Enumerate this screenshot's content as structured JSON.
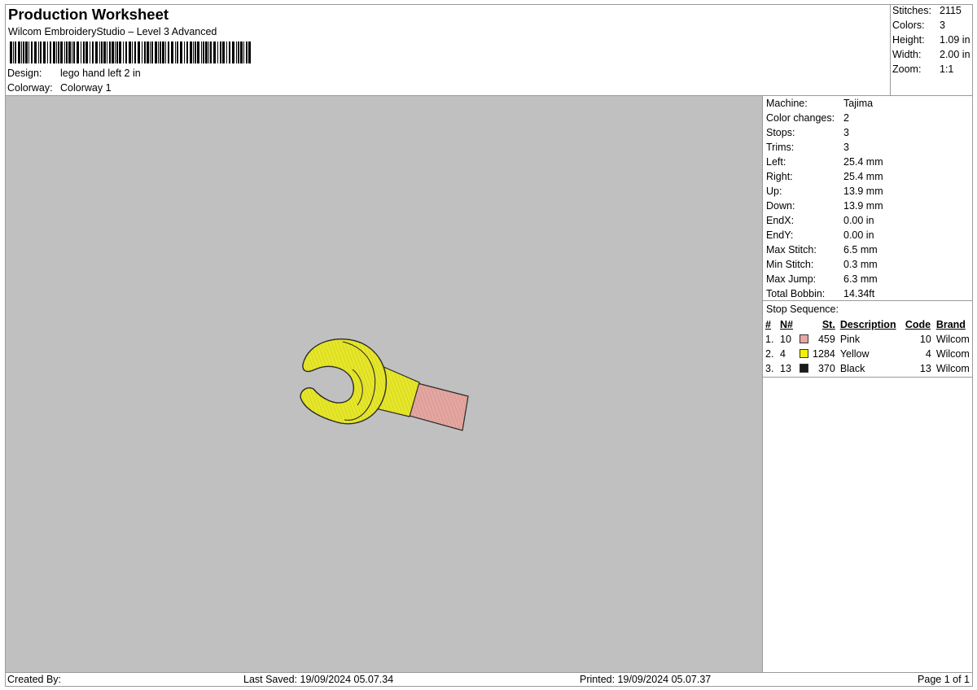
{
  "header": {
    "title": "Production Worksheet",
    "software": "Wilcom EmbroideryStudio – Level 3 Advanced",
    "design_label": "Design:",
    "design_value": "lego hand left 2 in",
    "colorway_label": "Colorway:",
    "colorway_value": "Colorway 1"
  },
  "stats": {
    "stitches_label": "Stitches:",
    "stitches_value": "2115",
    "colors_label": "Colors:",
    "colors_value": "3",
    "height_label": "Height:",
    "height_value": "1.09 in",
    "width_label": "Width:",
    "width_value": "2.00 in",
    "zoom_label": "Zoom:",
    "zoom_value": "1:1"
  },
  "machine": {
    "rows": [
      {
        "label": "Machine:",
        "value": "Tajima"
      },
      {
        "label": "Color changes:",
        "value": "2"
      },
      {
        "label": "Stops:",
        "value": "3"
      },
      {
        "label": "Trims:",
        "value": "3"
      },
      {
        "label": "Left:",
        "value": "25.4 mm"
      },
      {
        "label": "Right:",
        "value": "25.4 mm"
      },
      {
        "label": "Up:",
        "value": "13.9 mm"
      },
      {
        "label": "Down:",
        "value": "13.9 mm"
      },
      {
        "label": "EndX:",
        "value": "0.00 in"
      },
      {
        "label": "EndY:",
        "value": "0.00 in"
      },
      {
        "label": "Max Stitch:",
        "value": "6.5 mm"
      },
      {
        "label": "Min Stitch:",
        "value": "0.3 mm"
      },
      {
        "label": "Max Jump:",
        "value": "6.3 mm"
      },
      {
        "label": "Total Bobbin:",
        "value": "14.34ft"
      }
    ]
  },
  "stop_sequence": {
    "caption": "Stop Sequence:",
    "headers": {
      "num": "#",
      "needle": "N#",
      "stitches": "St.",
      "description": "Description",
      "code": "Code",
      "brand": "Brand"
    },
    "rows": [
      {
        "num": "1.",
        "needle": "10",
        "color": "#e8a7a3",
        "stitches": "459",
        "description": "Pink",
        "code": "10",
        "brand": "Wilcom"
      },
      {
        "num": "2.",
        "needle": "4",
        "color": "#f2f200",
        "stitches": "1284",
        "description": "Yellow",
        "code": "4",
        "brand": "Wilcom"
      },
      {
        "num": "3.",
        "needle": "13",
        "color": "#1a1a1a",
        "stitches": "370",
        "description": "Black",
        "code": "13",
        "brand": "Wilcom"
      }
    ]
  },
  "footer": {
    "created_by": "Created By:",
    "last_saved": "Last Saved: 19/09/2024 05.07.34",
    "printed": "Printed: 19/09/2024 05.07.37",
    "page": "Page 1 of 1"
  },
  "design_colors": {
    "canvas_bg": "#c0c0c0",
    "yellow": "#e6e62a",
    "pink": "#e3a6a0",
    "outline": "#2a2a2a"
  }
}
